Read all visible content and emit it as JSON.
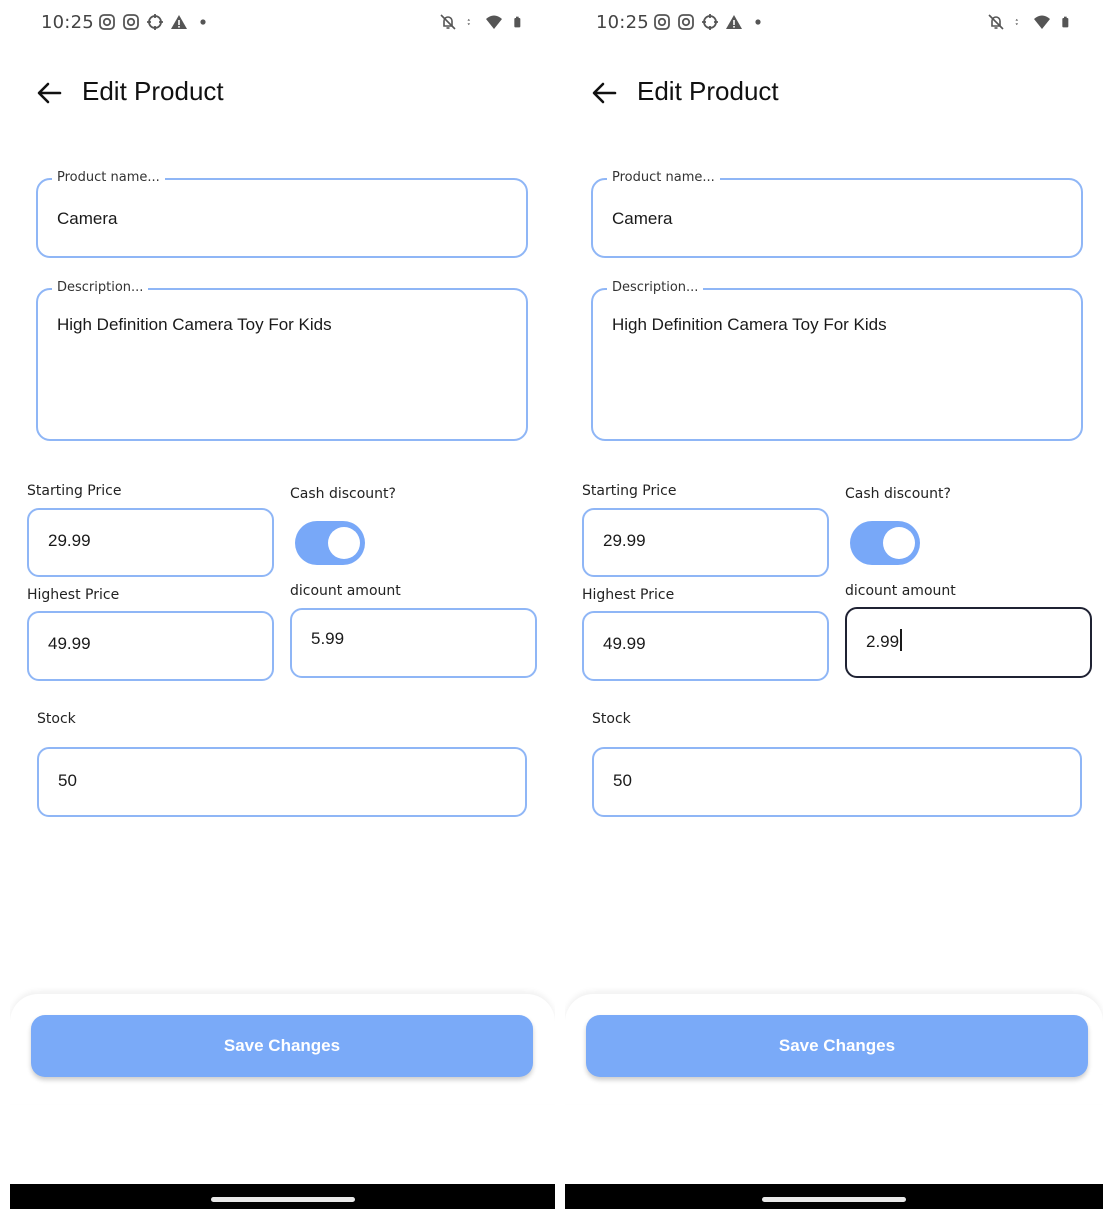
{
  "screens": [
    {
      "status_bar": {
        "time": "10:25"
      },
      "app_bar": {
        "title": "Edit Product"
      },
      "form": {
        "product_name": {
          "label": "Product name...",
          "value": "Camera"
        },
        "description": {
          "label": "Description...",
          "value": "High Definition Camera Toy For Kids"
        },
        "starting_price": {
          "label": "Starting Price",
          "value": "29.99"
        },
        "cash_discount": {
          "label": "Cash discount?",
          "enabled": true
        },
        "highest_price": {
          "label": "Highest Price",
          "value": "49.99"
        },
        "discount_amount": {
          "label": "dicount amount",
          "value": "5.99",
          "focused": false
        },
        "stock": {
          "label": "Stock",
          "value": "50"
        }
      },
      "save_button": {
        "label": "Save Changes"
      }
    },
    {
      "status_bar": {
        "time": "10:25"
      },
      "app_bar": {
        "title": "Edit Product"
      },
      "form": {
        "product_name": {
          "label": "Product name...",
          "value": "Camera"
        },
        "description": {
          "label": "Description...",
          "value": "High Definition Camera Toy For Kids"
        },
        "starting_price": {
          "label": "Starting Price",
          "value": "29.99"
        },
        "cash_discount": {
          "label": "Cash discount?",
          "enabled": true
        },
        "highest_price": {
          "label": "Highest Price",
          "value": "49.99"
        },
        "discount_amount": {
          "label": "dicount amount",
          "value": "2.99",
          "focused": true
        },
        "stock": {
          "label": "Stock",
          "value": "50"
        }
      },
      "save_button": {
        "label": "Save Changes"
      }
    }
  ],
  "colors": {
    "accent": "#7aaaf8",
    "field_border": "#8fb6f6",
    "focused_border": "#1f2233",
    "toggle_on": "#78a8f8"
  },
  "icons": {
    "status_left": [
      "instagram-icon",
      "instagram-icon",
      "crosshair-icon",
      "warning-icon",
      "dot-icon"
    ],
    "status_right": [
      "bell-off-icon",
      "data-arrows-icon",
      "wifi-icon",
      "battery-icon"
    ],
    "app_bar": "back-arrow-icon"
  }
}
